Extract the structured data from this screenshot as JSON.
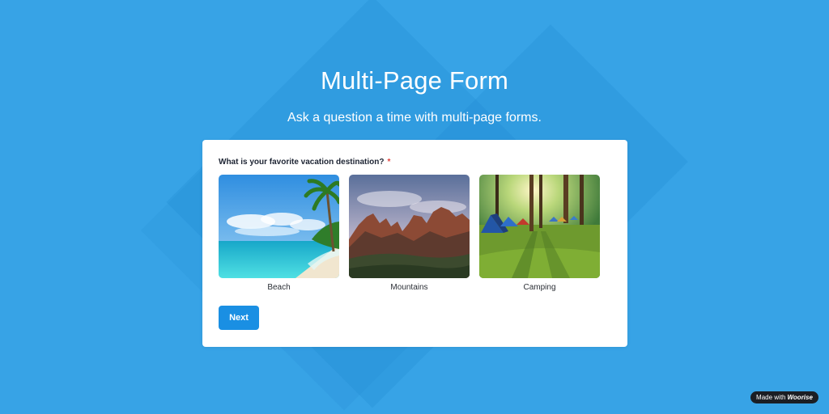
{
  "header": {
    "title": "Multi-Page Form",
    "subtitle": "Ask a question a time with multi-page forms."
  },
  "form": {
    "question": "What is your favorite vacation destination?",
    "required_mark": "*",
    "choices": [
      {
        "label": "Beach",
        "image": "beach-photo"
      },
      {
        "label": "Mountains",
        "image": "mountains-photo"
      },
      {
        "label": "Camping",
        "image": "camping-photo"
      }
    ],
    "next_label": "Next"
  },
  "footer": {
    "made_with": "Made with",
    "brand": "Woorise"
  },
  "colors": {
    "background": "#37a3e6",
    "card": "#ffffff",
    "button": "#1a8fe3",
    "required": "#e0413c",
    "badge": "#1b1e24"
  }
}
